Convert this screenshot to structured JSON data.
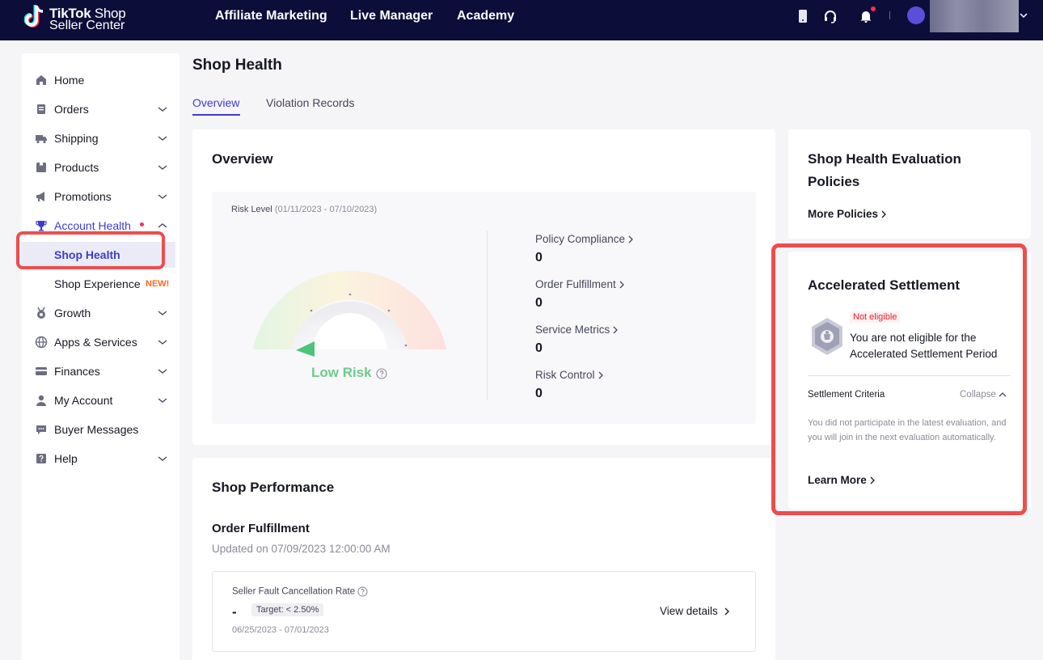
{
  "brand": {
    "name_bold": "TikTok",
    "name_light": " Shop",
    "subtitle": "Seller Center"
  },
  "top_nav": [
    {
      "label": "Affiliate Marketing"
    },
    {
      "label": "Live Manager"
    },
    {
      "label": "Academy"
    }
  ],
  "colors": {
    "topbar": "#0d0d3a",
    "accent": "#3c3ccf",
    "highlight": "#ee4d4d",
    "low_risk": "#6fca8d"
  },
  "sidebar": {
    "items": [
      {
        "label": "Home",
        "icon": "home-icon"
      },
      {
        "label": "Orders",
        "icon": "orders-icon"
      },
      {
        "label": "Shipping",
        "icon": "truck-icon"
      },
      {
        "label": "Products",
        "icon": "box-icon"
      },
      {
        "label": "Promotions",
        "icon": "megaphone-icon"
      },
      {
        "label": "Account Health",
        "icon": "trophy-icon"
      },
      {
        "label": "Growth",
        "icon": "medal-icon"
      },
      {
        "label": "Apps & Services",
        "icon": "globe-icon"
      },
      {
        "label": "Finances",
        "icon": "card-icon"
      },
      {
        "label": "My Account",
        "icon": "person-icon"
      },
      {
        "label": "Buyer Messages",
        "icon": "chat-icon"
      },
      {
        "label": "Help",
        "icon": "help-icon"
      }
    ],
    "sub_items": [
      {
        "label": "Shop Health"
      },
      {
        "label": "Shop Experience",
        "badge": "NEW!"
      }
    ]
  },
  "page": {
    "title": "Shop Health",
    "tabs": [
      {
        "label": "Overview"
      },
      {
        "label": "Violation Records"
      }
    ]
  },
  "overview": {
    "title": "Overview",
    "risk_level_label": "Risk Level",
    "risk_period": "(01/11/2023 - 07/10/2023)",
    "risk_status": "Low Risk",
    "metrics": [
      {
        "label": "Policy Compliance",
        "value": "0"
      },
      {
        "label": "Order Fulfillment",
        "value": "0"
      },
      {
        "label": "Service Metrics",
        "value": "0"
      },
      {
        "label": "Risk Control",
        "value": "0"
      }
    ]
  },
  "performance": {
    "title": "Shop Performance",
    "section_title": "Order Fulfillment",
    "updated": "Updated on 07/09/2023 12:00:00 AM",
    "metric_label": "Seller Fault Cancellation Rate",
    "metric_value": "-",
    "target": "Target: < 2.50%",
    "date_range": "06/25/2023 - 07/01/2023",
    "view_details": "View details"
  },
  "policies": {
    "title": "Shop Health Evaluation Policies",
    "more_link": "More Policies"
  },
  "settlement": {
    "title": "Accelerated Settlement",
    "status_badge": "Not eligible",
    "status_text": "You are not eligible for the Accelerated Settlement Period",
    "criteria_label": "Settlement Criteria",
    "collapse_label": "Collapse",
    "criteria_desc": "You did not participate in the latest evaluation, and you will join in the next evaluation automatically.",
    "learn_more": "Learn More"
  }
}
